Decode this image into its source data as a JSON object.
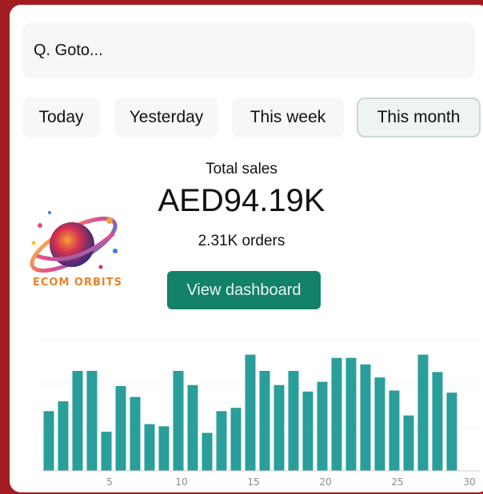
{
  "search": {
    "placeholder": "Q. Goto..."
  },
  "tabs": [
    {
      "label": "Today",
      "active": false
    },
    {
      "label": "Yesterday",
      "active": false
    },
    {
      "label": "This week",
      "active": false
    },
    {
      "label": "This month",
      "active": true
    }
  ],
  "summary": {
    "label": "Total sales",
    "value": "AED94.19K",
    "orders": "2.31K orders"
  },
  "cta": {
    "label": "View dashboard"
  },
  "logo": {
    "text": "ECOM ORBITS"
  },
  "colors": {
    "accent": "#138167",
    "bar": "#2a9e9a",
    "background": "#a31c22"
  },
  "chart_data": {
    "type": "bar",
    "x": [
      1,
      2,
      3,
      4,
      5,
      6,
      7,
      8,
      9,
      10,
      11,
      12,
      13,
      14,
      15,
      16,
      17,
      18,
      19,
      20,
      21,
      22,
      23,
      24,
      25,
      26,
      27,
      28,
      29,
      30
    ],
    "values": [
      55,
      64,
      92,
      92,
      36,
      78,
      68,
      43,
      41,
      92,
      79,
      35,
      55,
      58,
      107,
      92,
      79,
      92,
      73,
      82,
      104,
      104,
      98,
      86,
      74,
      51,
      107,
      91,
      72,
      0
    ],
    "x_tick_labels": [
      "5",
      "10",
      "15",
      "20",
      "25",
      "30"
    ],
    "xlim": [
      0,
      30
    ],
    "ylim": [
      0,
      120
    ],
    "grid": true
  }
}
